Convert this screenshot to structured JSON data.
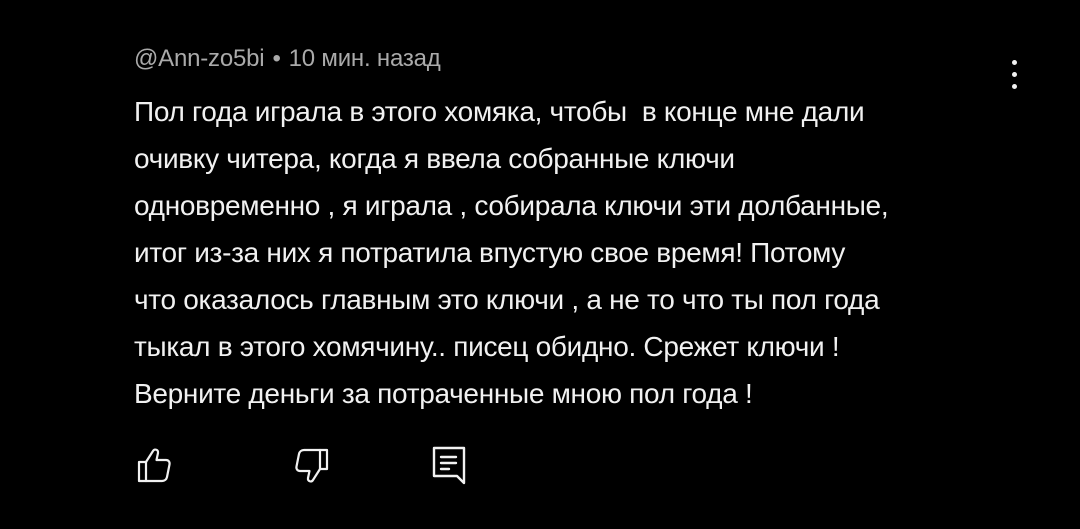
{
  "comment": {
    "author": "@Ann-zo5bi",
    "separator": "•",
    "timestamp": "10 мин. назад",
    "lines": [
      "Пол года играла в этого хомяка, чтобы  в конце мне дали",
      "очивку читера, когда я ввела собранные ключи",
      "одновременно , я играла , собирала ключи эти долбанные,",
      "итог из-за них я потратила впустую свое время! Потому",
      "что оказалось главным это ключи , а не то что ты пол года",
      "тыкал в этого хомячину.. писец обидно. Срежет ключи !",
      "Верните деньги за потраченные мною пол года !"
    ]
  },
  "actions": {
    "like_icon": "thumbs-up-icon",
    "dislike_icon": "thumbs-down-icon",
    "reply_icon": "reply-comment-icon",
    "more_icon": "more-vertical-icon"
  },
  "colors": {
    "background": "#000000",
    "text": "#f1f1f1",
    "meta": "#aaaaaa"
  }
}
